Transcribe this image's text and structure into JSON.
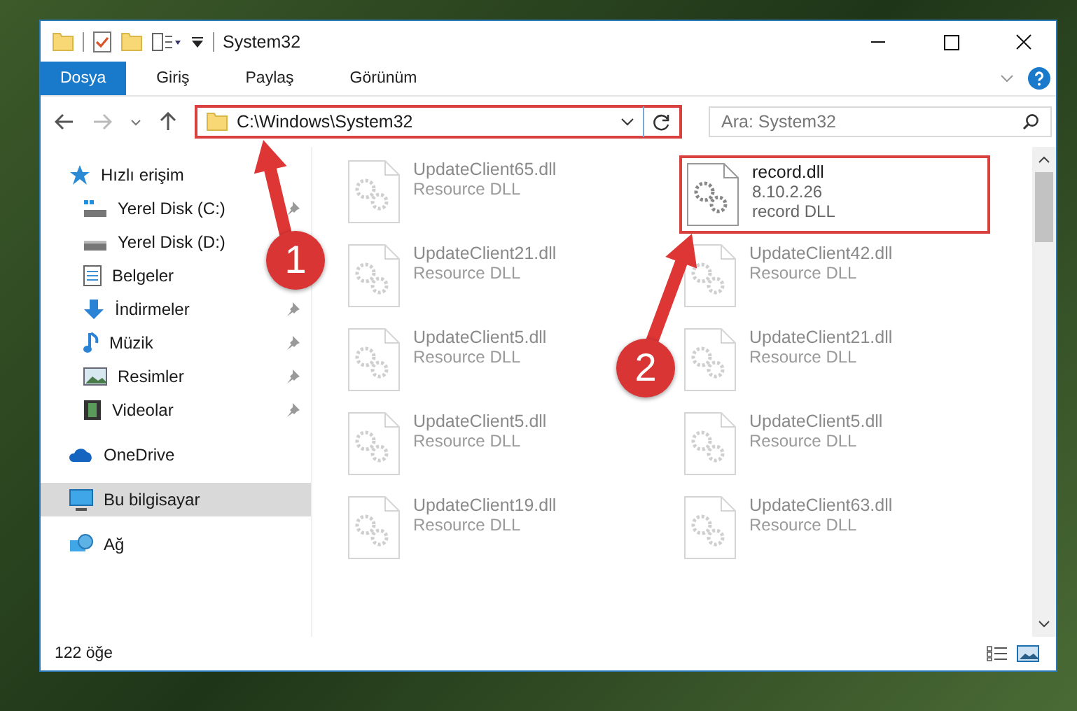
{
  "window": {
    "title": "System32"
  },
  "ribbon_tabs": [
    {
      "label": "Dosya",
      "selected": true
    },
    {
      "label": "Giriş",
      "selected": false
    },
    {
      "label": "Paylaş",
      "selected": false
    },
    {
      "label": "Görünüm",
      "selected": false
    }
  ],
  "address": {
    "path": "C:\\Windows\\System32",
    "highlighted": true
  },
  "search": {
    "placeholder": "Ara: System32"
  },
  "sidebar": {
    "items": [
      {
        "label": "Hızlı erişim",
        "kind": "star",
        "selected": false,
        "children": [
          {
            "label": "Yerel Disk (C:)",
            "kind": "drive-c",
            "pinned": true
          },
          {
            "label": "Yerel Disk (D:)",
            "kind": "drive",
            "pinned": false
          },
          {
            "label": "Belgeler",
            "kind": "docs",
            "pinned": false
          },
          {
            "label": "İndirmeler",
            "kind": "download",
            "pinned": true
          },
          {
            "label": "Müzik",
            "kind": "music",
            "pinned": true
          },
          {
            "label": "Resimler",
            "kind": "pictures",
            "pinned": true
          },
          {
            "label": "Videolar",
            "kind": "videos",
            "pinned": true
          }
        ]
      },
      {
        "label": "OneDrive",
        "kind": "cloud",
        "selected": false
      },
      {
        "label": "Bu bilgisayar",
        "kind": "computer",
        "selected": true
      },
      {
        "label": "Ağ",
        "kind": "network",
        "selected": false
      }
    ]
  },
  "files": [
    {
      "name": "UpdateClient65.dll",
      "lines": [
        "Resource DLL"
      ],
      "blurred": true,
      "highlighted": false
    },
    {
      "name": "record.dll",
      "lines": [
        "8.10.2.26",
        "record DLL"
      ],
      "blurred": false,
      "highlighted": true
    },
    {
      "name": "UpdateClient21.dll",
      "lines": [
        "Resource DLL"
      ],
      "blurred": true,
      "highlighted": false
    },
    {
      "name": "UpdateClient42.dll",
      "lines": [
        "Resource DLL"
      ],
      "blurred": true,
      "highlighted": false
    },
    {
      "name": "UpdateClient5.dll",
      "lines": [
        "Resource DLL"
      ],
      "blurred": true,
      "highlighted": false
    },
    {
      "name": "UpdateClient21.dll",
      "lines": [
        "Resource DLL"
      ],
      "blurred": true,
      "highlighted": false
    },
    {
      "name": "UpdateClient5.dll",
      "lines": [
        "Resource DLL"
      ],
      "blurred": true,
      "highlighted": false
    },
    {
      "name": "UpdateClient5.dll",
      "lines": [
        "Resource DLL"
      ],
      "blurred": true,
      "highlighted": false
    },
    {
      "name": "UpdateClient19.dll",
      "lines": [
        "Resource DLL"
      ],
      "blurred": true,
      "highlighted": false
    },
    {
      "name": "UpdateClient63.dll",
      "lines": [
        "Resource DLL"
      ],
      "blurred": true,
      "highlighted": false
    }
  ],
  "status_bar": {
    "count": "122 öğe"
  },
  "annotations": [
    {
      "number": "1"
    },
    {
      "number": "2"
    }
  ]
}
